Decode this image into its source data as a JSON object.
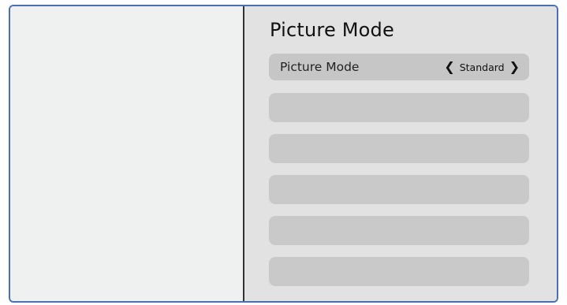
{
  "panel": {
    "title": "Picture Mode"
  },
  "menu": {
    "selected_row": {
      "label": "Picture Mode",
      "value": "Standard"
    },
    "empty_row_count": 5
  }
}
